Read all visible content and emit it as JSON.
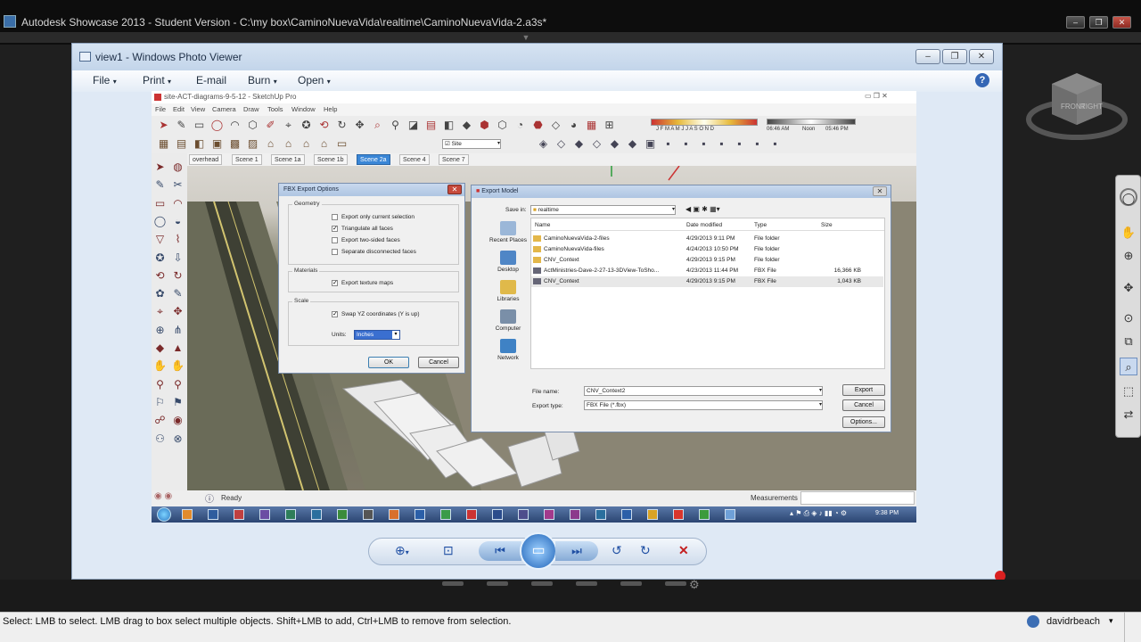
{
  "showcase": {
    "title": "Autodesk Showcase 2013 - Student Version - C:\\my box\\CaminoNuevaVida\\realtime\\CaminoNuevaVida-2.a3s*",
    "status_message": "Select: LMB to select. LMB drag to box select multiple objects. Shift+LMB to add, Ctrl+LMB to remove from selection.",
    "user": "davidrbeach"
  },
  "photo_viewer": {
    "title": "view1 - Windows Photo Viewer",
    "menu": [
      "File",
      "Print",
      "E-mail",
      "Burn",
      "Open"
    ]
  },
  "sketchup": {
    "title": "site-ACT-diagrams-9-5-12 - SketchUp Pro",
    "menu": [
      "File",
      "Edit",
      "View",
      "Camera",
      "Draw",
      "Tools",
      "Window",
      "Help"
    ],
    "layer_value": "Site",
    "time_start": "06:46 AM",
    "time_noon": "Noon",
    "time_end": "05:46 PM",
    "months": "J F M A M J J A S O N D",
    "scenes": [
      "overhead",
      "Scene 1",
      "Scene 1a",
      "Scene 1b",
      "Scene 2a",
      "Scene 4",
      "Scene 7"
    ],
    "active_scene": "Scene 2a",
    "status": "Ready",
    "measurements_label": "Measurements",
    "clock": "9:38 PM"
  },
  "fbx_dialog": {
    "title": "FBX Export Options",
    "geometry_label": "Geometry",
    "opt_selection": "Export only current selection",
    "opt_triangulate": "Triangulate all faces",
    "opt_twosided": "Export two-sided faces",
    "opt_separate": "Separate disconnected faces",
    "materials_label": "Materials",
    "opt_texture": "Export texture maps",
    "scale_label": "Scale",
    "opt_swap": "Swap YZ coordinates (Y is up)",
    "units_label": "Units:",
    "units_value": "Inches",
    "ok": "OK",
    "cancel": "Cancel"
  },
  "export_dialog": {
    "title": "Export Model",
    "save_in_label": "Save in:",
    "save_in_value": "realtime",
    "places": [
      "Recent Places",
      "Desktop",
      "Libraries",
      "Computer",
      "Network"
    ],
    "columns": [
      "Name",
      "Date modified",
      "Type",
      "Size"
    ],
    "files": [
      {
        "name": "CaminoNuevaVida-2-files",
        "date": "4/29/2013 9:11 PM",
        "type": "File folder",
        "size": ""
      },
      {
        "name": "CaminoNuevaVida-files",
        "date": "4/24/2013 10:50 PM",
        "type": "File folder",
        "size": ""
      },
      {
        "name": "CNV_Context",
        "date": "4/29/2013 9:15 PM",
        "type": "File folder",
        "size": ""
      },
      {
        "name": "ActMinistries-Dave-2-27-13-3DView-ToSho...",
        "date": "4/23/2013 11:44 PM",
        "type": "FBX File",
        "size": "16,366 KB"
      },
      {
        "name": "CNV_Context",
        "date": "4/29/2013 9:15 PM",
        "type": "FBX File",
        "size": "1,043 KB"
      }
    ],
    "file_name_label": "File name:",
    "file_name_value": "CNV_Context2",
    "export_type_label": "Export type:",
    "export_type_value": "FBX File (*.fbx)",
    "export_btn": "Export",
    "cancel_btn": "Cancel",
    "options_btn": "Options..."
  }
}
